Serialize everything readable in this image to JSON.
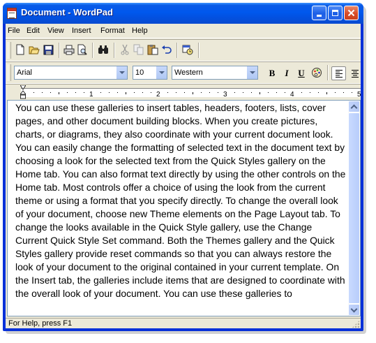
{
  "window": {
    "title": "Document - WordPad"
  },
  "menu": {
    "items": [
      "File",
      "Edit",
      "View",
      "Insert",
      "Format",
      "Help"
    ]
  },
  "toolbar": {
    "tools": [
      "new-icon",
      "open-icon",
      "save-icon",
      "print-icon",
      "print-preview-icon",
      "find-icon",
      "cut-icon",
      "copy-icon",
      "paste-icon",
      "undo-icon",
      "date-time-icon"
    ]
  },
  "format_bar": {
    "font": "Arial",
    "size": "10",
    "script": "Western",
    "bold_label": "B",
    "italic_label": "I",
    "underline_label": "U"
  },
  "ruler": {
    "numbers": [
      "1",
      "2",
      "3",
      "4",
      "5"
    ]
  },
  "document": {
    "text": "You can use these galleries to insert tables, headers, footers, lists, cover pages, and other document building blocks. When you create pictures, charts, or diagrams, they also coordinate with your current document look. You can easily change the formatting of selected text in the document text by choosing a look for the selected text from the Quick Styles gallery on the Home tab. You can also format text directly by using the other controls on the Home tab. Most controls offer a choice of using the look from the current theme or using a format that you specify directly. To change the overall look of your document, choose new Theme elements on the Page Layout tab. To change the looks available in the Quick Style gallery, use the Change Current Quick Style Set command. Both the Themes gallery and the Quick Styles gallery provide reset commands so that you can always restore the look of your document to the original contained in your current template. On the Insert tab, the galleries include items that are designed to coordinate with the overall look of your document. You can use these galleries to"
  },
  "status": {
    "text": "For Help, press F1"
  }
}
